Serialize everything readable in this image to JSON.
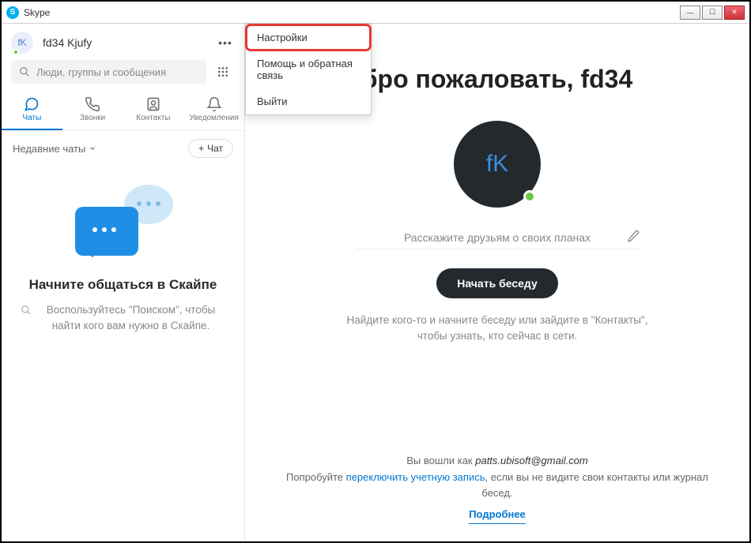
{
  "window": {
    "title": "Skype"
  },
  "user": {
    "avatar_initials": "fK",
    "display_name": "fd34 Kjufy"
  },
  "search": {
    "placeholder": "Люди, группы и сообщения"
  },
  "tabs": {
    "chats": "Чаты",
    "calls": "Звонки",
    "contacts": "Контакты",
    "notifications": "Уведомления"
  },
  "recent": {
    "label": "Недавние чаты",
    "new_chat": "Чат"
  },
  "empty_state": {
    "title": "Начните общаться в Скайпе",
    "subtitle": "Воспользуйтесь \"Поиском\", чтобы найти кого вам нужно в Скайпе."
  },
  "dropdown": {
    "settings": "Настройки",
    "help": "Помощь и обратная связь",
    "signout": "Выйти"
  },
  "main": {
    "welcome_prefix": "бро пожаловать, ",
    "welcome_name": "fd34",
    "avatar_initials": "fK",
    "status_placeholder": "Расскажите друзьям о своих планах",
    "start_button": "Начать беседу",
    "hint": "Найдите кого-то и начните беседу или зайдите в \"Контакты\", чтобы узнать, кто сейчас в сети."
  },
  "footer": {
    "signed_prefix": "Вы вошли как ",
    "email": "patts.ubisoft@gmail.com",
    "try_prefix": "Попробуйте ",
    "switch_link": "переключить учетную запись",
    "try_suffix": ", если вы не видите свои контакты или журнал бесед.",
    "more": "Подробнее"
  }
}
